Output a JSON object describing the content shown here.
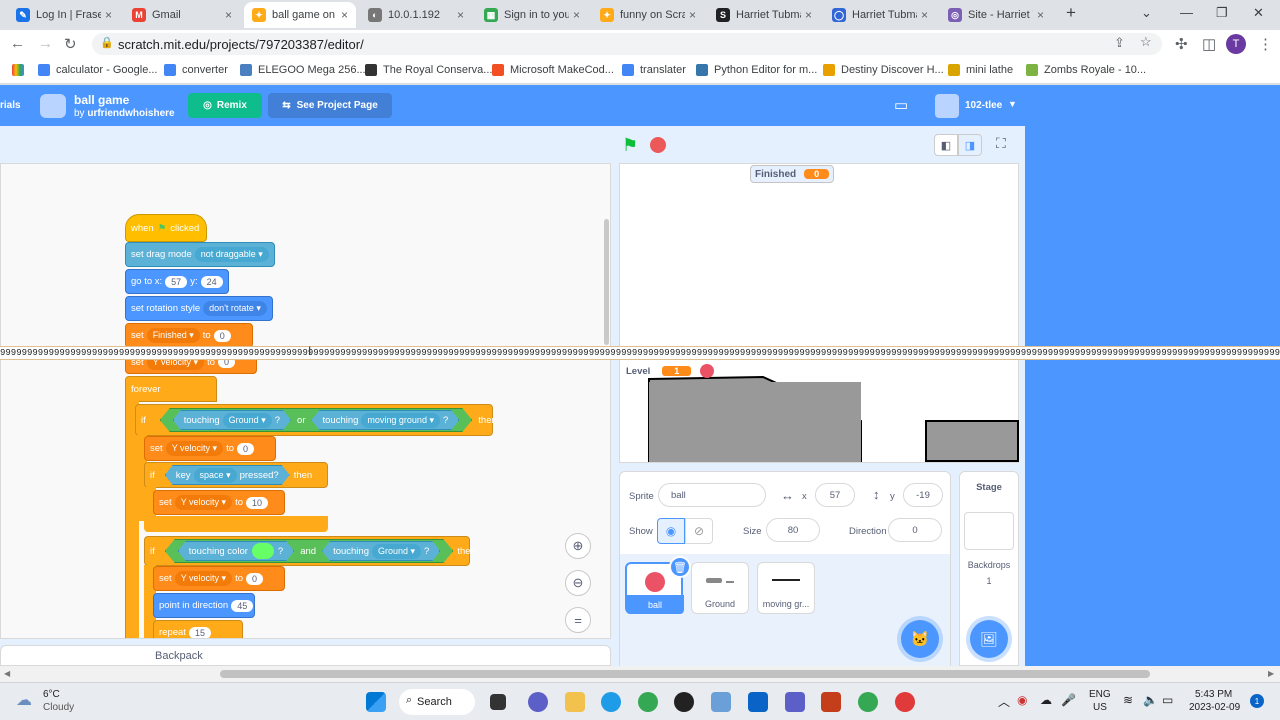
{
  "browser": {
    "tabs": [
      {
        "title": "Log In | Fraser",
        "color": "#1a73e8",
        "glyph": "✎"
      },
      {
        "title": "Gmail",
        "color": "#ea4335",
        "glyph": "M"
      },
      {
        "title": "ball game on S",
        "color": "#ffab19",
        "glyph": "✦",
        "active": true
      },
      {
        "title": "10.0.1.192",
        "color": "#777777",
        "glyph": "◐"
      },
      {
        "title": "Sign in to your",
        "color": "#34a853",
        "glyph": "▦"
      },
      {
        "title": "funny on Scrat",
        "color": "#ffab19",
        "glyph": "✦"
      },
      {
        "title": "Harriet Tubma",
        "color": "#202124",
        "glyph": "S"
      },
      {
        "title": "Harriet Tubma",
        "color": "#3367d6",
        "glyph": "◯"
      },
      {
        "title": "Site - Harriet T",
        "color": "#7b5fb5",
        "glyph": "◎"
      }
    ],
    "new_tab": "+",
    "url": "scratch.mit.edu/projects/797203387/editor/",
    "profile_initial": "T",
    "bookmarks": [
      "calculator - Google...",
      "converter",
      "ELEGOO Mega 256...",
      "The Royal Conserva...",
      "Microsoft MakeCod...",
      "translater",
      "Python Editor for m...",
      "Destiny Discover H...",
      "mini lathe",
      "Zombs Royale - 10..."
    ]
  },
  "scratch": {
    "menu_left": "rials",
    "project_title": "ball game",
    "author_prefix": "by",
    "author": "urfriendwhoishere",
    "remix": "Remix",
    "see_project": "See Project Page",
    "username": "102-tlee",
    "backpack": "Backpack"
  },
  "blocks": {
    "when": "when",
    "clicked": "clicked",
    "set_drag": "set drag mode",
    "not_draggable": "not draggable",
    "go_to": "go to x:",
    "gx": "57",
    "y": "y:",
    "gy": "24",
    "rot": "set rotation style",
    "dont_rotate": "don't rotate",
    "set": "set",
    "finished": "Finished",
    "to": "to",
    "zero": "0",
    "yvel_partial": "Y velocity",
    "forever": "forever",
    "if": "if",
    "then": "then",
    "touching": "touching",
    "ground": "Ground",
    "q": "?",
    "or": "or",
    "moving_ground": "moving ground",
    "y_velocity": "Y velocity",
    "key": "key",
    "space": "space",
    "pressed": "pressed?",
    "ten": "10",
    "touching_color": "touching color",
    "and": "and",
    "point_dir": "point in direction",
    "p45": "45",
    "repeat": "repeat",
    "r15": "15"
  },
  "stage": {
    "var1_label": "Finished",
    "var1_value": "0",
    "var2_label": "Level",
    "var2_value": "1"
  },
  "sprite_info": {
    "sprite_label": "Sprite",
    "sprite_name": "ball",
    "x_label": "x",
    "x_value": "57",
    "y_label": "y",
    "y_value": "-19",
    "show_label": "Show",
    "size_label": "Size",
    "size_value": "80",
    "direction_label": "Direction",
    "direction_value": "0"
  },
  "sprites": [
    "ball",
    "Ground",
    "moving gr..."
  ],
  "stage_panel": {
    "label": "Stage",
    "backdrops_label": "Backdrops",
    "backdrops_count": "1"
  },
  "overlay_text": "999999999999999999999999999999999999999999999999999999999999999999999999999999999999999999999999999999999999999999999999999999999999999999999999999999999999999999999999999999999999999999999999999999999999999999999999999999999999999999999999999",
  "taskbar": {
    "weather_temp": "6°C",
    "weather_desc": "Cloudy",
    "search": "Search",
    "lang1": "ENG",
    "lang2": "US",
    "time": "5:43 PM",
    "date": "2023-02-09",
    "notif": "1"
  },
  "colors": {
    "scratch_blue": "#4c97ff",
    "events": "#ffbf00",
    "control": "#ffab19",
    "variables": "#ff8c1a",
    "sensing": "#5cb1d6",
    "operators": "#59c059",
    "motion": "#4c97ff"
  }
}
